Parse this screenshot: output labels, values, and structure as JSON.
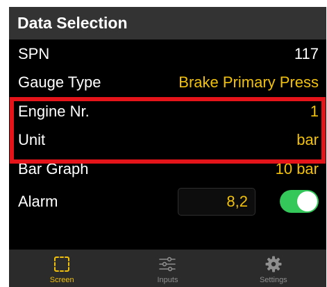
{
  "header": {
    "title": "Data Selection"
  },
  "rows": [
    {
      "label": "SPN",
      "value": "117"
    },
    {
      "label": "Gauge Type",
      "value": "Brake Primary Press"
    },
    {
      "label": "Engine Nr.",
      "value": "1"
    },
    {
      "label": "Unit",
      "value": "bar"
    },
    {
      "label": "Bar Graph",
      "value": "10 bar"
    }
  ],
  "alarm": {
    "label": "Alarm",
    "value": "8,2",
    "enabled": true
  },
  "tabs": [
    {
      "label": "Screen",
      "icon": "screen-icon",
      "active": true
    },
    {
      "label": "Inputs",
      "icon": "sliders-icon",
      "active": false
    },
    {
      "label": "Settings",
      "icon": "gear-icon",
      "active": false
    }
  ],
  "colors": {
    "accent": "#f2c10a",
    "highlight": "#e5141b",
    "toggle_on": "#34c759"
  }
}
